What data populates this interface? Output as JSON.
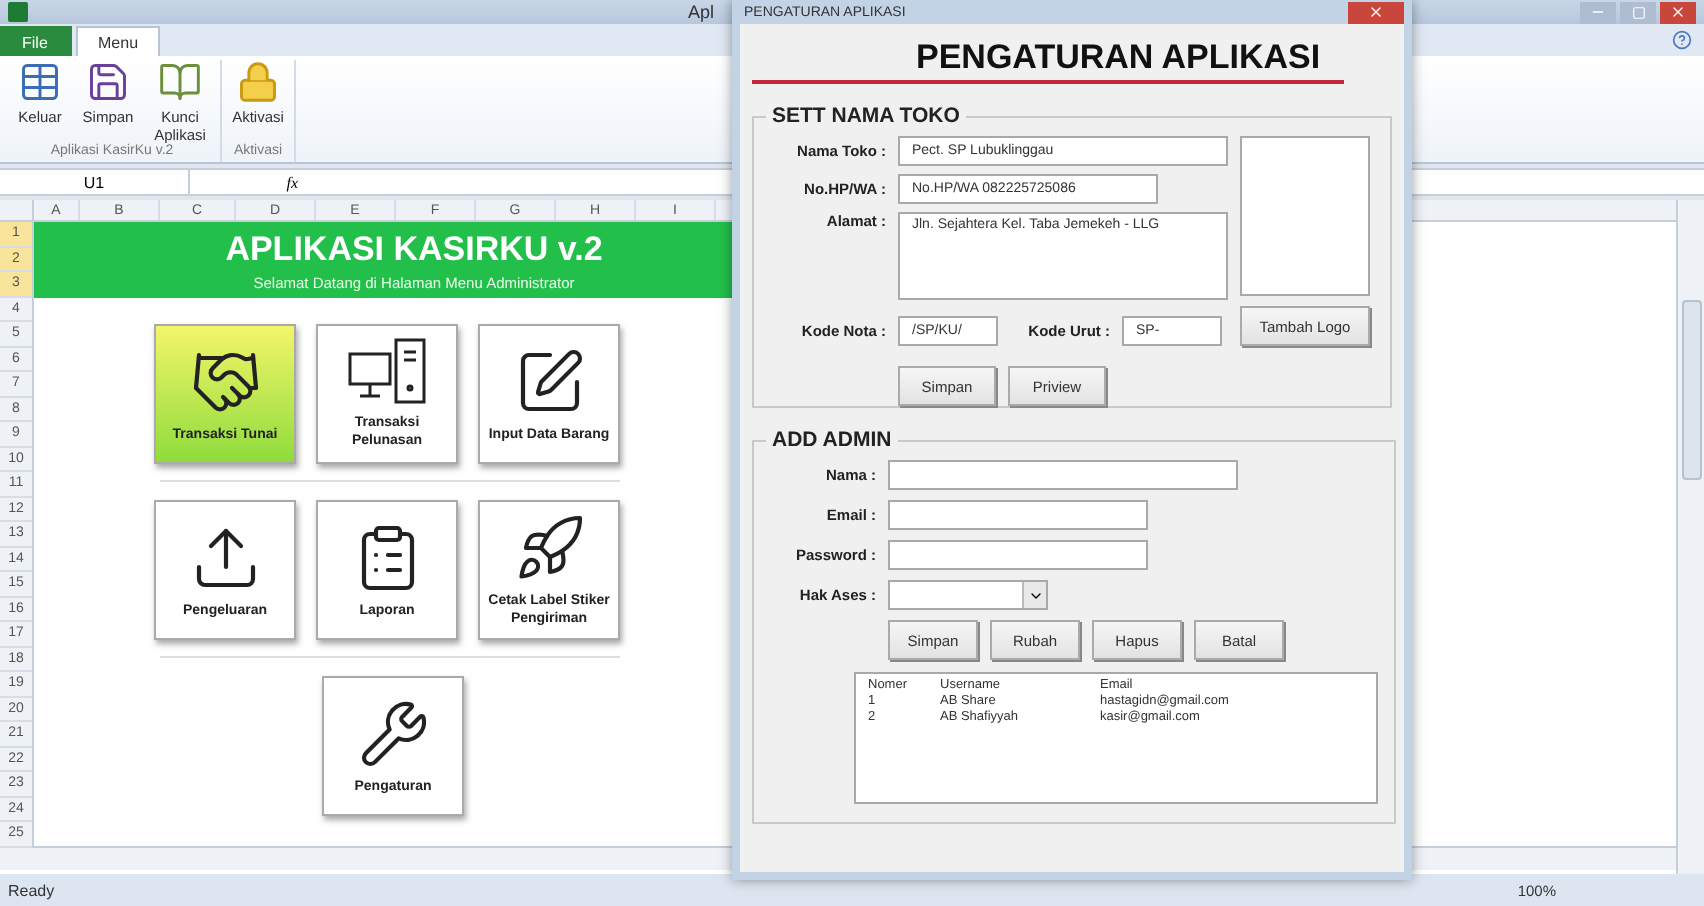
{
  "excel": {
    "title": "Apl",
    "tabs": [
      {
        "label": "File",
        "selected": false
      },
      {
        "label": "Menu",
        "selected": true
      }
    ],
    "ribbon_groups": [
      {
        "label": "Aplikasi KasirKu v.2",
        "buttons": [
          {
            "kind": "table",
            "label": "Keluar"
          },
          {
            "kind": "save",
            "label": "Simpan"
          },
          {
            "kind": "book",
            "label": "Kunci Aplikasi"
          }
        ]
      },
      {
        "label": "Aktivasi",
        "buttons": [
          {
            "kind": "lock",
            "label": "Aktivasi"
          }
        ]
      }
    ],
    "name_box": "U1",
    "function_label": "fx",
    "columns": [
      "A",
      "B",
      "C",
      "D",
      "E",
      "F",
      "G",
      "H",
      "I"
    ],
    "rows": [
      "1",
      "2",
      "3",
      "4",
      "5",
      "6",
      "7",
      "8",
      "9",
      "10",
      "11",
      "12",
      "13",
      "14",
      "15",
      "16",
      "17",
      "18",
      "19",
      "20",
      "21",
      "22",
      "23",
      "24",
      "25"
    ],
    "dashboard": {
      "title": "APLIKASI KASIRKU v.2",
      "subtitle": "Selamat Datang di Halaman Menu Administrator",
      "tile_rows": [
        [
          {
            "kind": "handshake",
            "label": "Transaksi  Tunai",
            "selected": true
          },
          {
            "kind": "computer",
            "label": "Transaksi Pelunasan",
            "selected": false
          },
          {
            "kind": "edit",
            "label": "Input Data Barang",
            "selected": false
          }
        ],
        [
          {
            "kind": "upload",
            "label": "Pengeluaran",
            "selected": false
          },
          {
            "kind": "clipboard",
            "label": "Laporan",
            "selected": false
          },
          {
            "kind": "rocket",
            "label": "Cetak Label Stiker Pengiriman",
            "selected": false
          }
        ],
        [
          {
            "kind": "wrench",
            "label": "Pengaturan",
            "selected": false
          }
        ]
      ]
    },
    "status_bar": {
      "status": "Ready",
      "zoom": "100%"
    }
  },
  "dialog": {
    "title": "PENGATURAN APLIKASI",
    "heading": "PENGATURAN APLIKASI",
    "store": {
      "legend": "SETT NAMA TOKO",
      "name": {
        "label": "Nama Toko :",
        "value": "Pect. SP Lubuklinggau"
      },
      "phone": {
        "label": "No.HP/WA :",
        "value": "No.HP/WA 082225725086"
      },
      "address": {
        "label": "Alamat :",
        "value": "Jln. Sejahtera Kel. Taba Jemekeh - LLG"
      },
      "note_code": {
        "label": "Kode Nota :",
        "value": "/SP/KU/"
      },
      "sequence_code": {
        "label": "Kode Urut :",
        "value": "SP-"
      },
      "logo_button": "Tambah Logo",
      "buttons": [
        "Simpan",
        "Priview"
      ]
    },
    "admin": {
      "legend": "ADD ADMIN",
      "fields": [
        {
          "kind": "name",
          "label": "Nama :"
        },
        {
          "kind": "email",
          "label": "Email :"
        },
        {
          "kind": "password",
          "label": "Password :"
        },
        {
          "kind": "combo",
          "label": "Hak Ases :"
        }
      ],
      "buttons": [
        "Simpan",
        "Rubah",
        "Hapus",
        "Batal"
      ],
      "list_columns": [
        "Nomer",
        "Username",
        "Email"
      ],
      "list_rows": [
        [
          "1",
          "AB Share",
          "hastagidn@gmail.com"
        ],
        [
          "2",
          "AB Shafiyyah",
          "kasir@gmail.com"
        ]
      ]
    }
  }
}
